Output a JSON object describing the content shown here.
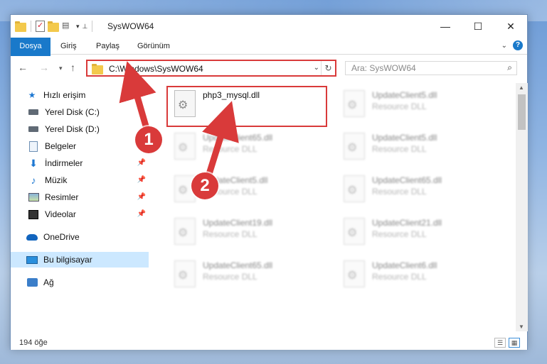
{
  "window": {
    "title": "SysWOW64",
    "buttons": {
      "minimize": "—",
      "maximize": "☐",
      "close": "✕"
    }
  },
  "ribbon": {
    "tabs": [
      "Dosya",
      "Giriş",
      "Paylaş",
      "Görünüm"
    ]
  },
  "navigation": {
    "address": "C:\\Windows\\SysWOW64",
    "search_placeholder": "Ara: SysWOW64"
  },
  "sidebar": {
    "items": [
      {
        "label": "Hızlı erişim",
        "icon": "star-icon"
      },
      {
        "label": "Yerel Disk (C:)",
        "icon": "drive-icon"
      },
      {
        "label": "Yerel Disk (D:)",
        "icon": "drive-icon"
      },
      {
        "label": "Belgeler",
        "icon": "documents-icon"
      },
      {
        "label": "İndirmeler",
        "icon": "download-icon"
      },
      {
        "label": "Müzik",
        "icon": "music-icon"
      },
      {
        "label": "Resimler",
        "icon": "pictures-icon"
      },
      {
        "label": "Videolar",
        "icon": "videos-icon"
      },
      {
        "label": "OneDrive",
        "icon": "cloud-icon"
      },
      {
        "label": "Bu bilgisayar",
        "icon": "computer-icon"
      },
      {
        "label": "Ağ",
        "icon": "network-icon"
      }
    ]
  },
  "files": [
    {
      "name": "php3_mysql.dll",
      "type": ""
    },
    {
      "name": "UpdateClient5.dll",
      "type": "Resource DLL"
    },
    {
      "name": "UpdateClient65.dll",
      "type": "Resource DLL"
    },
    {
      "name": "UpdateClient5.dll",
      "type": "Resource DLL"
    },
    {
      "name": "UpdateClient5.dll",
      "type": "Resource DLL"
    },
    {
      "name": "UpdateClient65.dll",
      "type": "Resource DLL"
    },
    {
      "name": "UpdateClient19.dll",
      "type": "Resource DLL"
    },
    {
      "name": "UpdateClient21.dll",
      "type": "Resource DLL"
    },
    {
      "name": "UpdateClient65.dll",
      "type": "Resource DLL"
    },
    {
      "name": "UpdateClient6.dll",
      "type": "Resource DLL"
    }
  ],
  "status": {
    "item_count": "194 öğe"
  },
  "annotations": {
    "step1": "1",
    "step2": "2",
    "color": "#d93a3a"
  }
}
